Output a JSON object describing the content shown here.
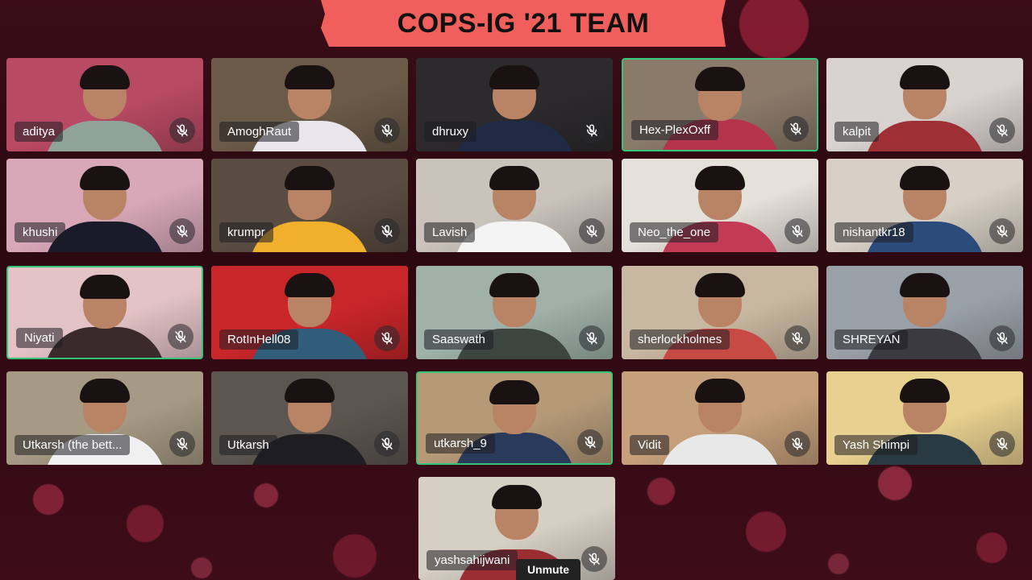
{
  "banner": {
    "title": "COPS-IG '21 TEAM"
  },
  "participants": [
    {
      "name": "aditya",
      "bg": "#b84a63",
      "shirt": "#8fa39a",
      "active": false
    },
    {
      "name": "AmoghRaut",
      "bg": "#6b5a48",
      "shirt": "#e8e6ea",
      "active": false
    },
    {
      "name": "dhruxy",
      "bg": "#2c2a2c",
      "shirt": "#1f2a44",
      "active": false
    },
    {
      "name": "Hex-PlexOxff",
      "bg": "#8a7a6a",
      "shirt": "#b5344c",
      "active": true
    },
    {
      "name": "kalpit",
      "bg": "#d9d3cf",
      "shirt": "#9e2f35",
      "active": false
    },
    {
      "name": "khushi",
      "bg": "#d8a8b8",
      "shirt": "#1a1a2a",
      "active": false
    },
    {
      "name": "krumpr",
      "bg": "#5a4c40",
      "shirt": "#f0b02c",
      "active": false
    },
    {
      "name": "Lavish",
      "bg": "#c9c3bc",
      "shirt": "#f4f4f4",
      "active": false
    },
    {
      "name": "Neo_the_one",
      "bg": "#e4e0da",
      "shirt": "#c23a56",
      "active": false
    },
    {
      "name": "nishantkr18",
      "bg": "#d8d0c6",
      "shirt": "#2b4c7a",
      "active": false
    },
    {
      "name": "Niyati",
      "bg": "#e3c3c6",
      "shirt": "#3a2a2a",
      "active": true
    },
    {
      "name": "RotInHell08",
      "bg": "#c9262a",
      "shirt": "#2f5d7a",
      "active": false
    },
    {
      "name": "Saaswath",
      "bg": "#9fb1a9",
      "shirt": "#3c4540",
      "active": false
    },
    {
      "name": "sherlockholmes",
      "bg": "#c9b8a1",
      "shirt": "#c74a45",
      "active": false
    },
    {
      "name": "SHREYAN",
      "bg": "#9aa0a8",
      "shirt": "#3a3a40",
      "active": false
    },
    {
      "name": "Utkarsh (the bett...",
      "bg": "#a69a84",
      "shirt": "#f0f0f0",
      "active": false
    },
    {
      "name": "Utkarsh",
      "bg": "#5c5650",
      "shirt": "#1e1e22",
      "active": false
    },
    {
      "name": "utkarsh_9",
      "bg": "#b69a78",
      "shirt": "#2a3a5a",
      "active": true
    },
    {
      "name": "Vidit",
      "bg": "#c6a07a",
      "shirt": "#e8e8e8",
      "active": false
    },
    {
      "name": "Yash Shimpi",
      "bg": "#e8d090",
      "shirt": "#2a3a42",
      "active": false
    },
    {
      "name": "yashsahijwani",
      "bg": "#d6cfc4",
      "shirt": "#9b2e33",
      "active": false
    }
  ],
  "controls": {
    "unmute_label": "Unmute"
  },
  "icons": {
    "mic": "mic-off-icon"
  }
}
